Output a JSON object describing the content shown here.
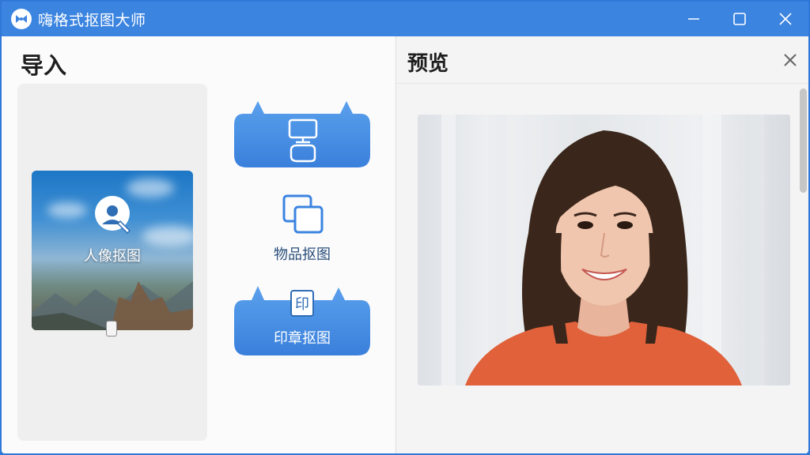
{
  "window": {
    "title": "嗨格式抠图大师",
    "accent_color": "#3b84e0",
    "controls": [
      "minimize-icon",
      "maximize-icon",
      "close-icon"
    ]
  },
  "import_panel": {
    "title": "导入",
    "portrait_button": {
      "label": "人像抠图",
      "icon": "portrait-cutout-icon"
    },
    "top_button": {
      "label": "",
      "icon": "screen-transfer-icon"
    },
    "object_button": {
      "label": "物品抠图",
      "icon": "layers-icon"
    },
    "stamp_button": {
      "label": "印章抠图",
      "icon": "stamp-icon"
    }
  },
  "preview_panel": {
    "title": "预览",
    "close_icon": "close-icon",
    "image": "portrait-photo-woman-orange-shirt"
  }
}
